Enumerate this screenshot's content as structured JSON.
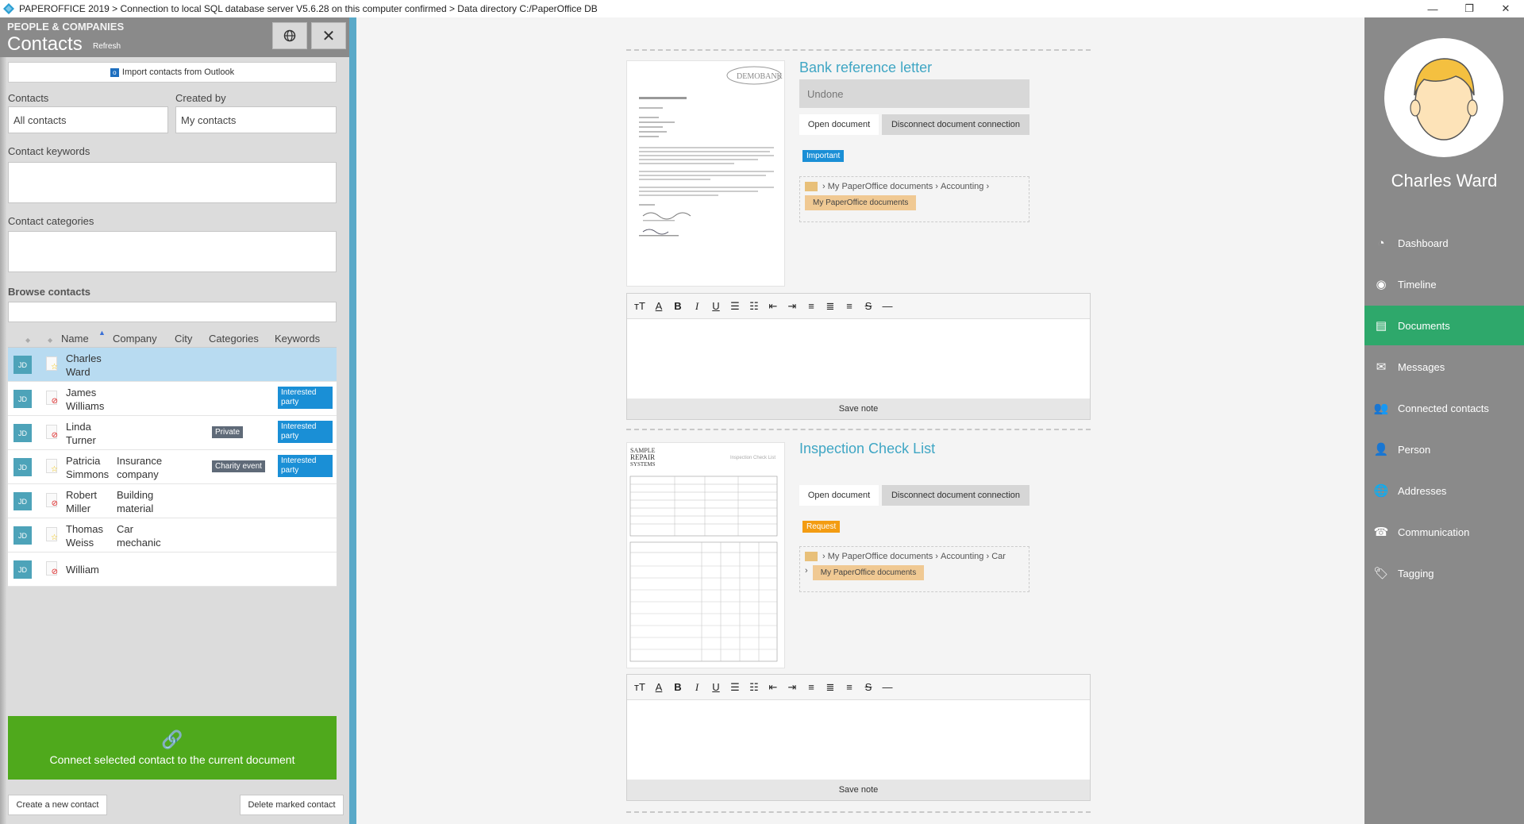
{
  "titlebar": {
    "text": "PAPEROFFICE 2019 > Connection to local SQL database server V5.6.28 on this computer confirmed > Data directory C:/PaperOffice DB",
    "minimize": "—",
    "maximize": "❐",
    "close": "✕"
  },
  "left_panel": {
    "section_label": "PEOPLE & COMPANIES",
    "title": "Contacts",
    "refresh": "Refresh",
    "import_outlook": "Import contacts from Outlook",
    "contacts_label": "Contacts",
    "contacts_value": "All contacts",
    "created_by_label": "Created by",
    "created_by_value": "My contacts",
    "keywords_label": "Contact keywords",
    "categories_label": "Contact categories",
    "browse_label": "Browse contacts",
    "columns": [
      "Name",
      "Company",
      "City",
      "Categories",
      "Keywords"
    ],
    "rows": [
      {
        "initials": "JD",
        "first": "Charles",
        "last": "Ward",
        "company1": "",
        "company2": "",
        "category": "",
        "keyword1": "",
        "keyword2": "",
        "selected": true,
        "mark": "star"
      },
      {
        "initials": "JD",
        "first": "James",
        "last": "Williams",
        "company1": "",
        "company2": "",
        "category": "",
        "keyword1": "Interested",
        "keyword2": "party",
        "selected": false,
        "mark": "no"
      },
      {
        "initials": "JD",
        "first": "Linda",
        "last": "Turner",
        "company1": "",
        "company2": "",
        "category": "Private",
        "keyword1": "Interested",
        "keyword2": "party",
        "selected": false,
        "mark": "no"
      },
      {
        "initials": "JD",
        "first": "Patricia",
        "last": "Simmons",
        "company1": "Insurance",
        "company2": "company",
        "category": "Charity event",
        "keyword1": "Interested",
        "keyword2": "party",
        "selected": false,
        "mark": "star"
      },
      {
        "initials": "JD",
        "first": "Robert",
        "last": "Miller",
        "company1": "Building",
        "company2": "material",
        "category": "",
        "keyword1": "",
        "keyword2": "",
        "selected": false,
        "mark": "no"
      },
      {
        "initials": "JD",
        "first": "Thomas",
        "last": "Weiss",
        "company1": "Car",
        "company2": "mechanic",
        "category": "",
        "keyword1": "",
        "keyword2": "",
        "selected": false,
        "mark": "star"
      },
      {
        "initials": "JD",
        "first": "William",
        "last": "",
        "company1": "",
        "company2": "",
        "category": "",
        "keyword1": "",
        "keyword2": "",
        "selected": false,
        "mark": "no"
      }
    ],
    "connect_button": "Connect selected contact to the current document",
    "create_button": "Create a new contact",
    "delete_button": "Delete marked contact"
  },
  "documents": [
    {
      "title": "Bank reference letter",
      "status": "Undone",
      "open": "Open document",
      "disconnect": "Disconnect document connection",
      "tag": "Important",
      "tag_color": "#1a8fd6",
      "path": [
        "My PaperOffice documents",
        "Accounting"
      ],
      "chip": "My PaperOffice documents",
      "save_note": "Save note"
    },
    {
      "title": "Inspection Check List",
      "status": "",
      "open": "Open document",
      "disconnect": "Disconnect document connection",
      "tag": "Request",
      "tag_color": "#f39c12",
      "path": [
        "My PaperOffice documents",
        "Accounting",
        "Car"
      ],
      "chip": "My PaperOffice documents",
      "save_note": "Save note"
    }
  ],
  "right_panel": {
    "person_name": "Charles Ward",
    "nav": [
      {
        "label": "Dashboard",
        "icon": "dashboard-icon",
        "active": false
      },
      {
        "label": "Timeline",
        "icon": "timeline-icon",
        "active": false
      },
      {
        "label": "Documents",
        "icon": "documents-icon",
        "active": true
      },
      {
        "label": "Messages",
        "icon": "messages-icon",
        "active": false
      },
      {
        "label": "Connected contacts",
        "icon": "connected-contacts-icon",
        "active": false
      },
      {
        "label": "Person",
        "icon": "person-icon",
        "active": false
      },
      {
        "label": "Addresses",
        "icon": "addresses-icon",
        "active": false
      },
      {
        "label": "Communication",
        "icon": "communication-icon",
        "active": false
      },
      {
        "label": "Tagging",
        "icon": "tagging-icon",
        "active": false
      }
    ]
  },
  "colors": {
    "accent_blue": "#3fa6c4",
    "active_green": "#2ea86b",
    "connect_green": "#4fa91c",
    "panel_gray": "#8a8a8a"
  }
}
